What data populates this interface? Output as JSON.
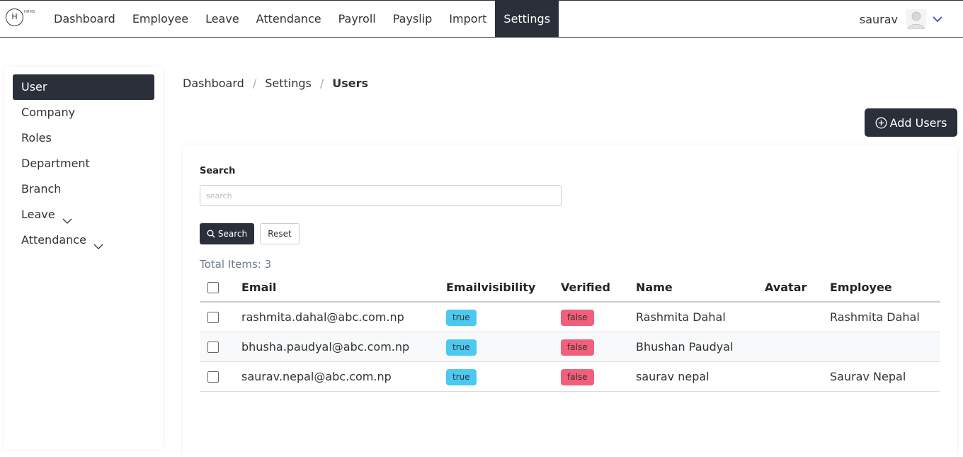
{
  "app": {
    "logo_letter": "H",
    "logo_sub": "HRMS"
  },
  "nav": {
    "items": [
      "Dashboard",
      "Employee",
      "Leave",
      "Attendance",
      "Payroll",
      "Payslip",
      "Import",
      "Settings"
    ],
    "active": "Settings"
  },
  "user": {
    "name": "saurav"
  },
  "sidebar": {
    "items": [
      "User",
      "Company",
      "Roles",
      "Department",
      "Branch",
      "Leave",
      "Attendance"
    ],
    "active": "User"
  },
  "breadcrumb": {
    "items": [
      "Dashboard",
      "Settings",
      "Users"
    ],
    "separator": "/"
  },
  "actions": {
    "add_label": "Add Users"
  },
  "search": {
    "label": "Search",
    "placeholder": "search",
    "value": "",
    "search_button": "Search",
    "reset_button": "Reset"
  },
  "table": {
    "total_label": "Total Items: 3",
    "columns": [
      "Email",
      "Emailvisibility",
      "Verified",
      "Name",
      "Avatar",
      "Employee"
    ],
    "rows": [
      {
        "email": "rashmita.dahal@abc.com.np",
        "emailvisibility": "true",
        "verified": "false",
        "name": "Rashmita Dahal",
        "avatar": "",
        "employee": "Rashmita Dahal"
      },
      {
        "email": "bhusha.paudyal@abc.com.np",
        "emailvisibility": "true",
        "verified": "false",
        "name": "Bhushan Paudyal",
        "avatar": "",
        "employee": ""
      },
      {
        "email": "saurav.nepal@abc.com.np",
        "emailvisibility": "true",
        "verified": "false",
        "name": "saurav nepal",
        "avatar": "",
        "employee": "Saurav Nepal"
      }
    ]
  },
  "colors": {
    "dark": "#2b2f3a",
    "badge_true": "#4cc9f0",
    "badge_false": "#f25f7a",
    "chevron": "#4a5bd8"
  }
}
